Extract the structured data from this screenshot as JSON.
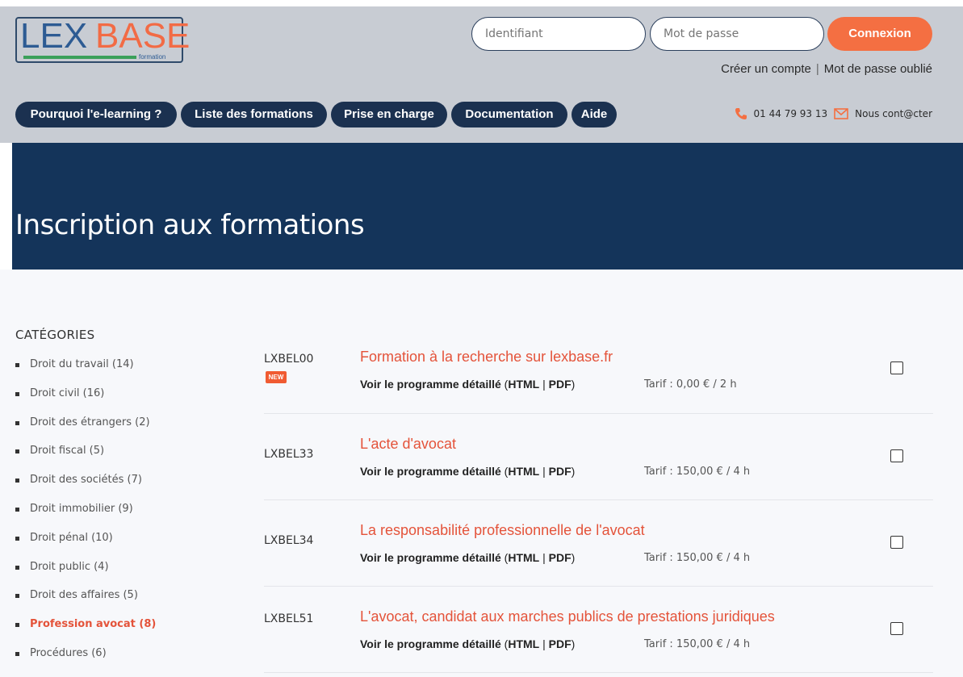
{
  "logo": {
    "part1": "LEX",
    "part2": "BASE",
    "sub": "formation"
  },
  "login": {
    "id_placeholder": "Identifiant",
    "pw_placeholder": "Mot de passe",
    "button": "Connexion",
    "create_account": "Créer un compte",
    "separator": "|",
    "forgot": "Mot de passe oublié"
  },
  "nav": [
    "Pourquoi l'e-learning ?",
    "Liste des formations",
    "Prise en charge",
    "Documentation",
    "Aide"
  ],
  "contact": {
    "phone": "01 44 79 93 13",
    "mail": "Nous cont@cter"
  },
  "banner": {
    "title": "Inscription aux formations"
  },
  "sidebar": {
    "title": "CATÉGORIES",
    "items": [
      "Droit du travail (14)",
      "Droit civil (16)",
      "Droit des étrangers (2)",
      "Droit fiscal (5)",
      "Droit des sociétés (7)",
      "Droit immobilier (9)",
      "Droit pénal (10)",
      "Droit public (4)",
      "Droit des affaires (5)",
      "Profession avocat (8)",
      "Procédures (6)"
    ],
    "active_item": "Profession avocat (8)"
  },
  "courses": [
    {
      "code": "LXBEL00",
      "badge": "NEW",
      "title": "Formation à la recherche sur lexbase.fr",
      "prog_label": "Voir le programme détaillé",
      "prog_open": " (",
      "html": "HTML",
      "pipe": " | ",
      "pdf": "PDF",
      "prog_close": ")",
      "tarif": "Tarif : 0,00 € / 2 h"
    },
    {
      "code": "LXBEL33",
      "badge": "",
      "title": "L'acte d'avocat",
      "prog_label": "Voir le programme détaillé",
      "prog_open": " (",
      "html": "HTML",
      "pipe": " | ",
      "pdf": "PDF",
      "prog_close": ")",
      "tarif": "Tarif : 150,00 € / 4 h"
    },
    {
      "code": "LXBEL34",
      "badge": "",
      "title": "La responsabilité professionnelle de l'avocat",
      "prog_label": "Voir le programme détaillé",
      "prog_open": " (",
      "html": "HTML",
      "pipe": " | ",
      "pdf": "PDF",
      "prog_close": ")",
      "tarif": "Tarif : 150,00 € / 4 h"
    },
    {
      "code": "LXBEL51",
      "badge": "",
      "title": "L'avocat, candidat aux marches publics de prestations juridiques",
      "prog_label": "Voir le programme détaillé",
      "prog_open": " (",
      "html": "HTML",
      "pipe": " | ",
      "pdf": "PDF",
      "prog_close": ")",
      "tarif": "Tarif : 150,00 € / 4 h"
    }
  ],
  "colors": {
    "header_bg": "#c8ccd3",
    "nav_pill": "#1b3150",
    "banner": "#14345a",
    "accent": "#f46f42",
    "title_red": "#e4533a"
  },
  "icons": {
    "phone": "phone-icon",
    "mail": "mail-icon"
  }
}
